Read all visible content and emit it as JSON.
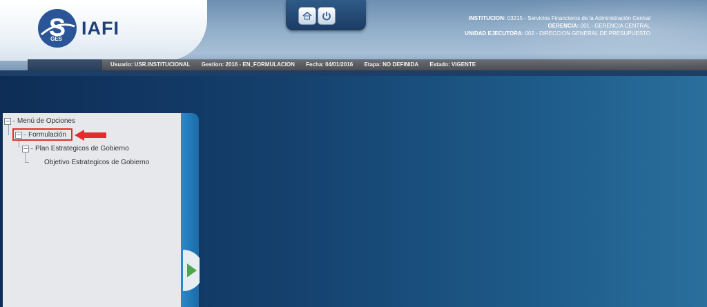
{
  "brand": {
    "mark": "S",
    "name": "IAFI",
    "sub": "GES"
  },
  "toolbar": {
    "home_icon": "home-icon",
    "power_icon": "power-icon"
  },
  "institution": {
    "institucion_label": "INSTITUCION:",
    "institucion_value": "03215 - Servicios Financieros de la Administración Central",
    "gerencia_label": "GERENCIA:",
    "gerencia_value": "001 - GERENCIA CENTRAL",
    "unidad_label": "UNIDAD EJECUTORA:",
    "unidad_value": "002 - DIRECCION GENERAL DE PRESUPUESTO"
  },
  "status": {
    "usuario": "Usuario: USR.INSTITUCIONAL",
    "gestion": "Gestion: 2016 - EN_FORMULACION",
    "fecha": "Fecha: 04/01/2016",
    "etapa": "Etapa: NO DEFINIDA",
    "estado": "Estado: VIGENTE"
  },
  "menu": {
    "root": "Menú de Opciones",
    "items": [
      {
        "label": "Formulación"
      },
      {
        "label": "Plan Estrategicos de Gobierno"
      },
      {
        "label": "Objetivo Estrategicos de Gobierno"
      }
    ]
  },
  "colors": {
    "highlight": "#e32d2d",
    "brand": "#1e3f77",
    "strip": "#2a8acb"
  }
}
